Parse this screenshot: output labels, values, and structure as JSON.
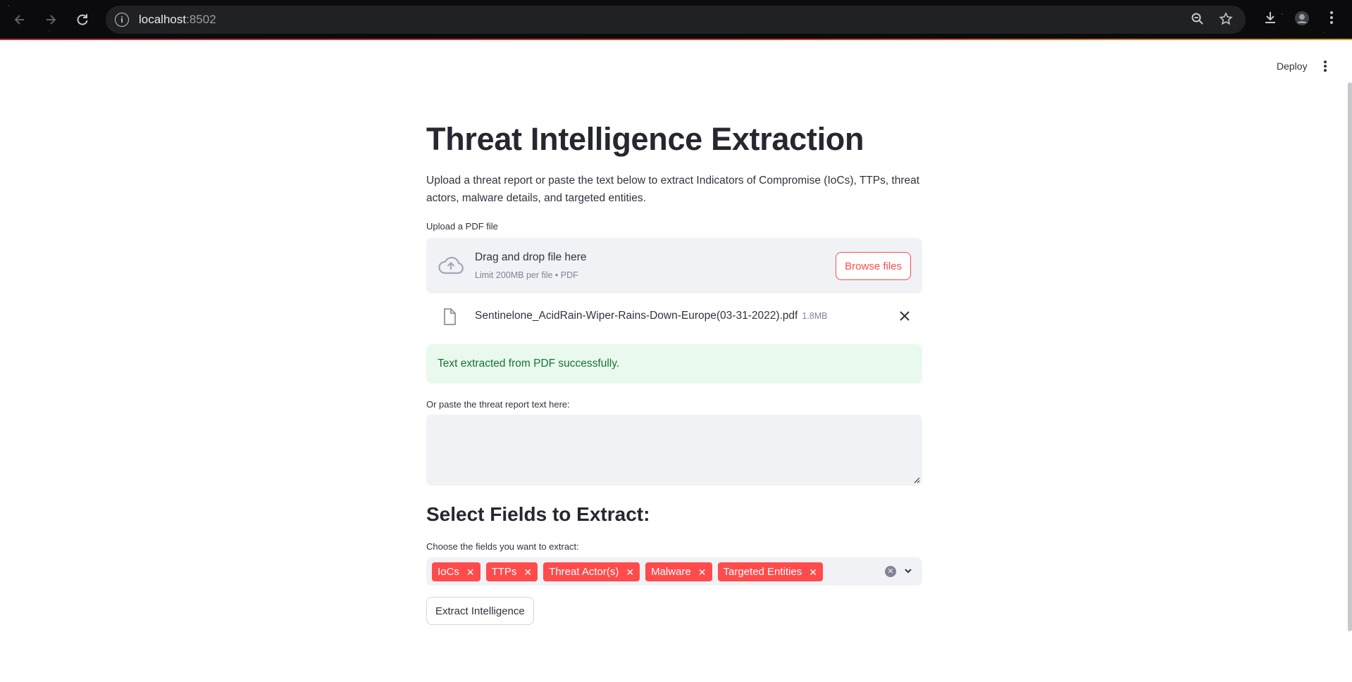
{
  "browser": {
    "url_host": "localhost",
    "url_port": ":8502",
    "info_icon": "info-icon",
    "icons": [
      "back-icon",
      "forward-icon",
      "reload-icon",
      "zoom-icon",
      "star-icon",
      "download-icon",
      "profile-icon",
      "menu-icon"
    ]
  },
  "header": {
    "deploy_label": "Deploy"
  },
  "main": {
    "title": "Threat Intelligence Extraction",
    "description": "Upload a threat report or paste the text below to extract Indicators of Compromise (IoCs), TTPs, threat actors, malware details, and targeted entities.",
    "upload": {
      "label": "Upload a PDF file",
      "drop_title": "Drag and drop file here",
      "drop_sub": "Limit 200MB per file • PDF",
      "browse_label": "Browse files"
    },
    "file": {
      "name": "Sentinelone_AcidRain-Wiper-Rains-Down-Europe(03-31-2022).pdf",
      "size": "1.8MB"
    },
    "success_message": "Text extracted from PDF successfully.",
    "paste_label": "Or paste the threat report text here:",
    "paste_value": "",
    "section_title": "Select Fields to Extract:",
    "fields_label": "Choose the fields you want to extract:",
    "fields": [
      {
        "label": "IoCs"
      },
      {
        "label": "TTPs"
      },
      {
        "label": "Threat Actor(s)"
      },
      {
        "label": "Malware"
      },
      {
        "label": "Targeted Entities"
      }
    ],
    "extract_label": "Extract Intelligence"
  },
  "colors": {
    "primary": "#ff4b4b",
    "success_bg": "#e9f9ee",
    "success_text": "#177233",
    "input_bg": "#f0f2f6",
    "text": "#31333f"
  }
}
